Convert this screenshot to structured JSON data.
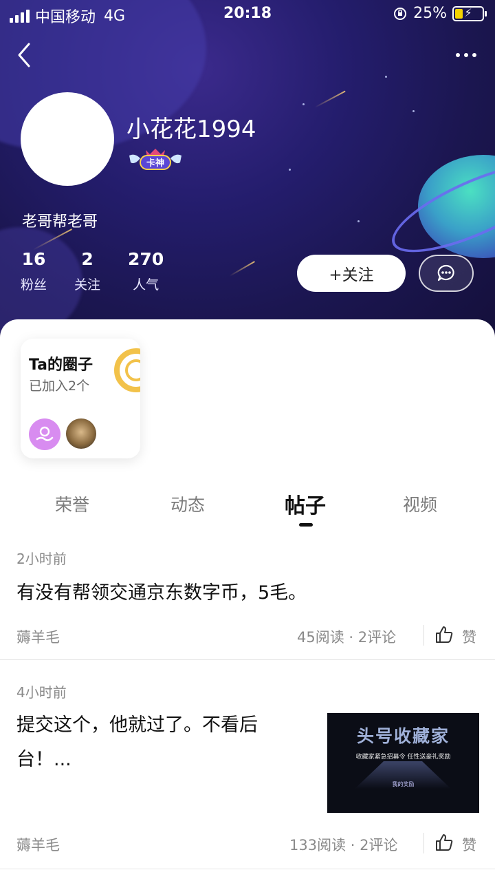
{
  "status_bar": {
    "carrier": "中国移动",
    "network": "4G",
    "time": "20:18",
    "battery": "25%"
  },
  "profile": {
    "username": "小花花1994",
    "badge_label": "卡神",
    "bio": "老哥帮老哥",
    "stats": [
      {
        "value": "16",
        "label": "粉丝"
      },
      {
        "value": "2",
        "label": "关注"
      },
      {
        "value": "270",
        "label": "人气"
      }
    ],
    "follow_label": "+关注"
  },
  "circle_card": {
    "title": "Ta的圈子",
    "subtitle": "已加入2个"
  },
  "tabs": [
    {
      "label": "荣誉",
      "active": false
    },
    {
      "label": "动态",
      "active": false
    },
    {
      "label": "帖子",
      "active": true
    },
    {
      "label": "视频",
      "active": false
    }
  ],
  "posts": [
    {
      "time": "2小时前",
      "text": "有没有帮领交通京东数字币，5毛。",
      "author": "薅羊毛",
      "meta": "45阅读 · 2评论",
      "like_label": "赞"
    },
    {
      "time": "4小时前",
      "text_line1": "提交这个，他就过了。不看后",
      "text_line2": "台！...",
      "author": "薅羊毛",
      "meta": "133阅读 · 2评论",
      "like_label": "赞",
      "thumbnail": {
        "headline": "头号收藏家",
        "subline": "收藏家紧急招募令 任性送豪礼奖励",
        "link": "我的奖励"
      }
    }
  ],
  "icons": [
    "back-icon",
    "more-icon",
    "alarm-lock-icon",
    "battery-charging-icon",
    "message-icon",
    "thumbs-up-icon"
  ],
  "colors": {
    "header_bg": "#1b1650",
    "follow_bg": "#ffffff",
    "gold": "#f2c24a",
    "purple_avatar": "#d88cf0"
  }
}
